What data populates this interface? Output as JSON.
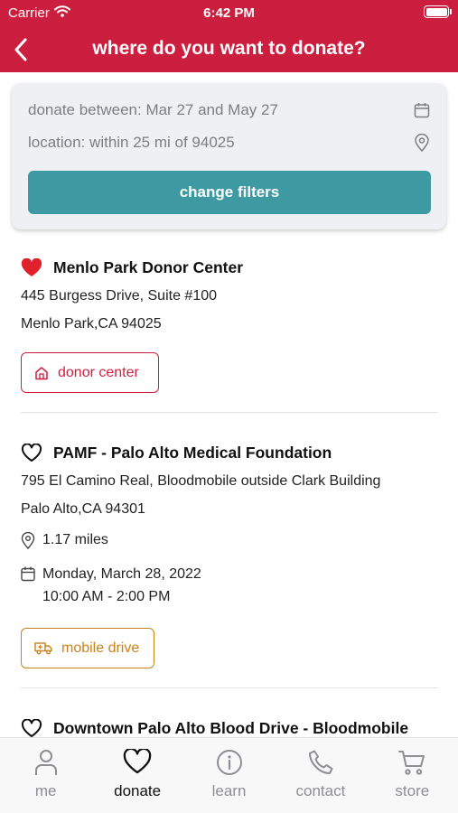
{
  "status_bar": {
    "carrier": "Carrier",
    "time": "6:42 PM"
  },
  "nav": {
    "title": "where do you want to donate?"
  },
  "filters": {
    "date_text": "donate between: Mar 27 and May 27",
    "location_text": "location: within 25 mi of 94025",
    "change_label": "change filters"
  },
  "locations": [
    {
      "name": "Menlo Park Donor Center",
      "favorite": true,
      "address1": "445 Burgess Drive, Suite #100",
      "address2": "Menlo Park,CA 94025",
      "badge": "donor center"
    },
    {
      "name": "PAMF - Palo Alto Medical Foundation",
      "favorite": false,
      "address1": "795 El Camino Real, Bloodmobile outside Clark Building",
      "address2": "Palo Alto,CA 94301",
      "distance": "1.17 miles",
      "date": "Monday, March 28, 2022",
      "time": "10:00 AM - 2:00 PM",
      "badge": "mobile drive"
    },
    {
      "name": "Downtown Palo Alto Blood Drive - Bloodmobile",
      "favorite": false
    }
  ],
  "tabs": [
    {
      "label": "me",
      "icon": "person-icon",
      "active": false
    },
    {
      "label": "donate",
      "icon": "heart-icon",
      "active": true
    },
    {
      "label": "learn",
      "icon": "info-icon",
      "active": false
    },
    {
      "label": "contact",
      "icon": "phone-icon",
      "active": false
    },
    {
      "label": "store",
      "icon": "cart-icon",
      "active": false
    }
  ],
  "colors": {
    "brand_red": "#cc1f3f",
    "teal_button": "#3d9aa3",
    "donor_badge": "#d0203f",
    "mobile_badge": "#c9811c",
    "favorite_heart": "#e0202a"
  }
}
